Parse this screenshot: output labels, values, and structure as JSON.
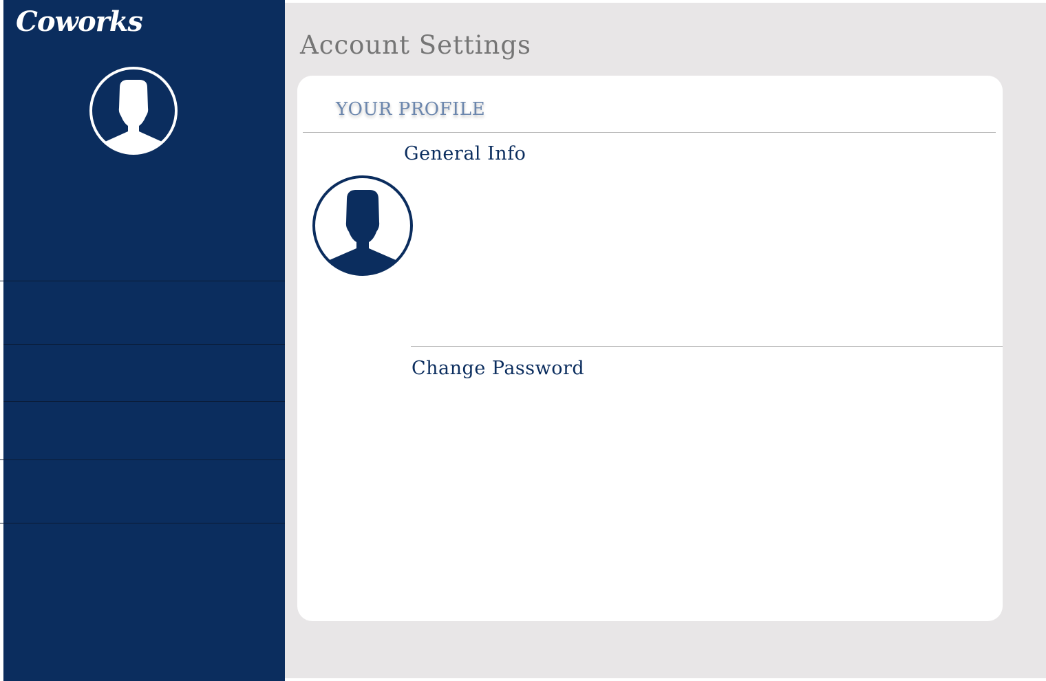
{
  "app": {
    "logo_text": "Coworks"
  },
  "sidebar": {
    "avatar_icon": "user-silhouette-icon",
    "items": [
      {
        "label": ""
      },
      {
        "label": ""
      },
      {
        "label": ""
      },
      {
        "label": ""
      }
    ]
  },
  "main": {
    "page_title": "Account Settings",
    "card": {
      "profile_heading": "YOUR PROFILE",
      "general_info_title": "General Info",
      "change_password_title": "Change Password",
      "avatar_icon": "user-silhouette-icon"
    }
  },
  "colors": {
    "sidebar_bg": "#0b2d5e",
    "main_bg": "#e8e6e7",
    "card_bg": "#ffffff",
    "heading_accent": "#6b86ad",
    "page_title": "#757575"
  }
}
